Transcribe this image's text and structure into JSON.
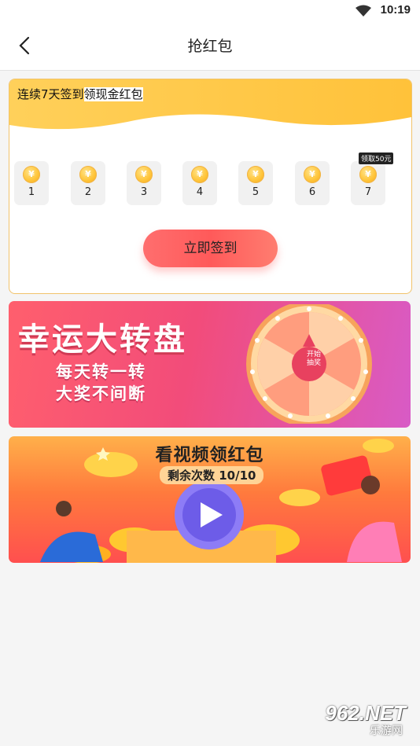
{
  "status_bar": {
    "time": "10:19",
    "wifi_icon": "wifi-icon"
  },
  "header": {
    "title": "抢红包",
    "back_icon": "chevron-left-icon"
  },
  "signin": {
    "title_prefix": "连续7天签到",
    "title_highlight": "领现金红包",
    "coin_symbol": "¥",
    "days": [
      "1",
      "2",
      "3",
      "4",
      "5",
      "6",
      "7"
    ],
    "day7_tag": "领取50元",
    "button_label": "立即签到",
    "accent_color": "#ffc94a"
  },
  "wheel_banner": {
    "title": "幸运大转盘",
    "line1": "每天转一转",
    "line2": "大奖不间断",
    "start_label_1": "开始",
    "start_label_2": "抽奖"
  },
  "video_banner": {
    "title": "看视频领红包",
    "remaining": "剩余次数 10/10"
  },
  "watermark": {
    "brand": "962.NET",
    "sub": "乐游网"
  }
}
